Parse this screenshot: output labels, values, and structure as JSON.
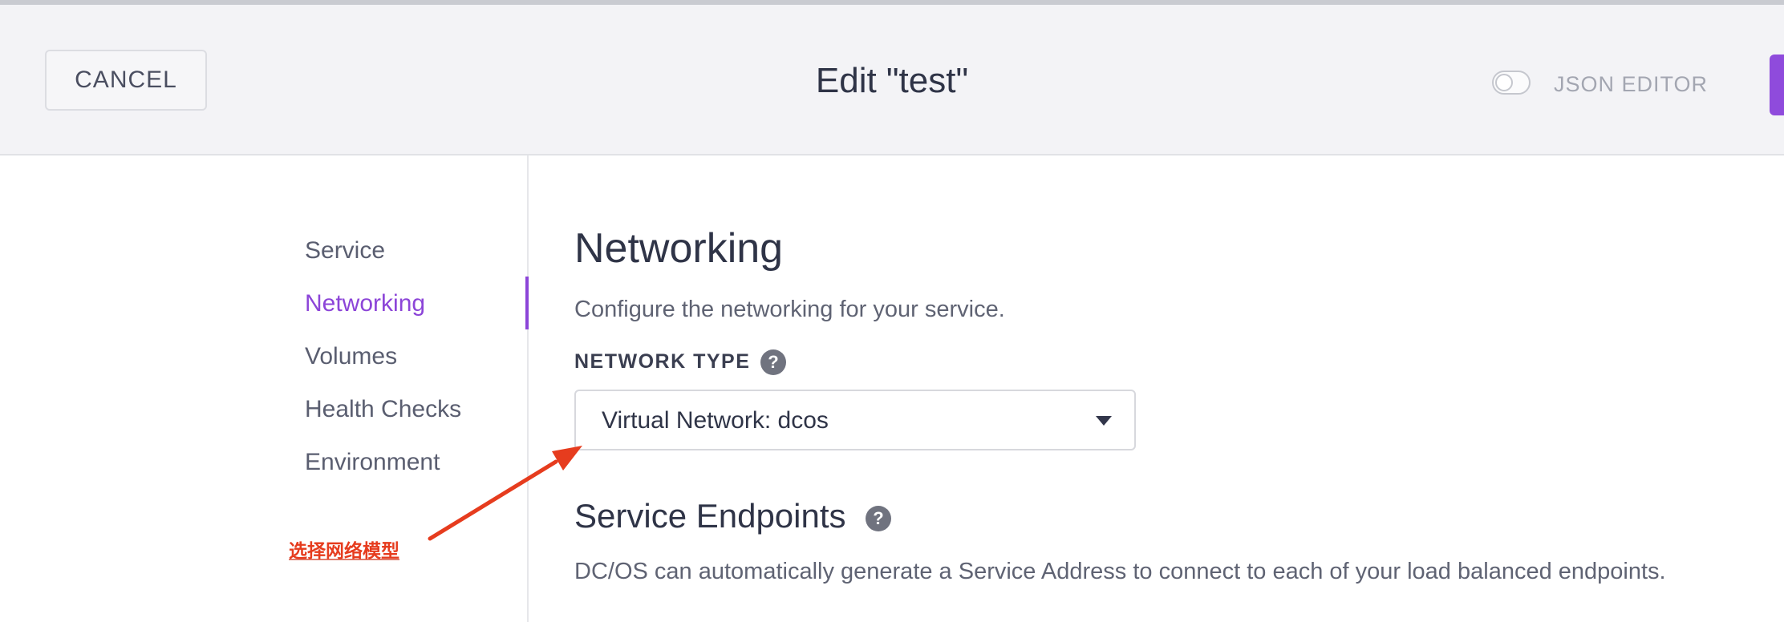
{
  "header": {
    "cancel_label": "CANCEL",
    "title": "Edit \"test\"",
    "json_editor_label": "JSON EDITOR",
    "json_editor_enabled": false
  },
  "sidebar": {
    "items": [
      {
        "label": "Service",
        "active": false
      },
      {
        "label": "Networking",
        "active": true
      },
      {
        "label": "Volumes",
        "active": false
      },
      {
        "label": "Health Checks",
        "active": false
      },
      {
        "label": "Environment",
        "active": false
      }
    ]
  },
  "main": {
    "title": "Networking",
    "description": "Configure the networking for your service.",
    "network_type": {
      "label": "NETWORK TYPE",
      "help_icon": "?",
      "selected": "Virtual Network: dcos"
    },
    "endpoints": {
      "title": "Service Endpoints",
      "help_icon": "?",
      "description": "DC/OS can automatically generate a Service Address to connect to each of your load balanced endpoints."
    }
  },
  "annotation": {
    "text": "选择网络模型",
    "icon": "arrow-icon",
    "color": "#e63c1e"
  },
  "colors": {
    "accent": "#8c45d8",
    "header_bg": "#f3f3f6",
    "text": "#32364a"
  }
}
